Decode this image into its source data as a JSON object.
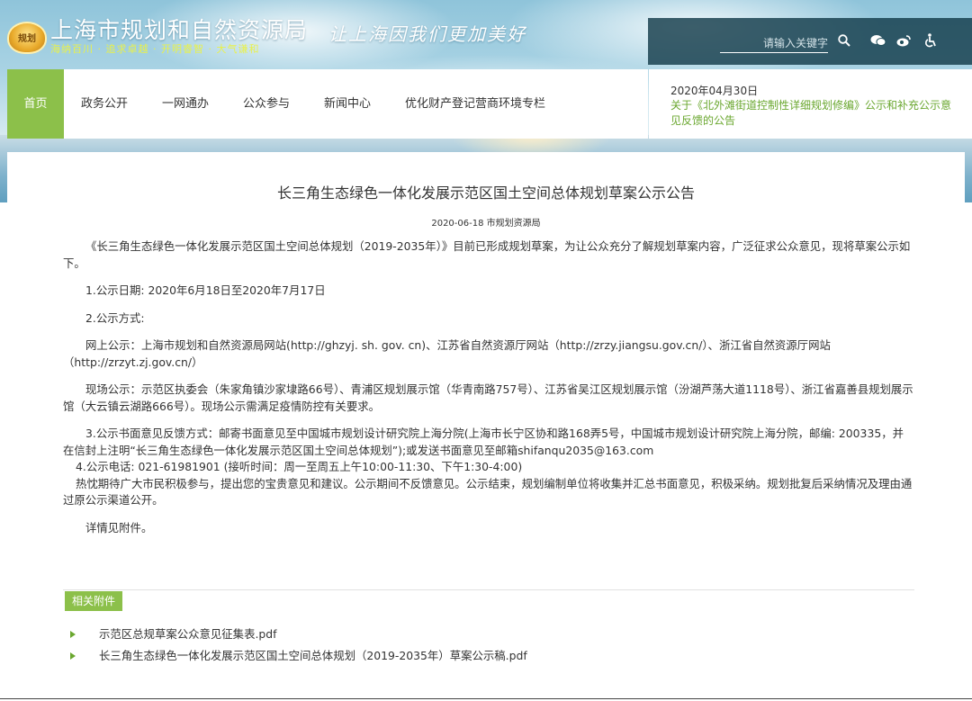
{
  "header": {
    "emblem_text": "规划",
    "site_title": "上海市规划和自然资源局",
    "tagline": "海纳百川 · 追求卓越 · 开明睿智 · 大气谦和",
    "slogan": "让上海因我们更加美好",
    "search_placeholder": "请输入关键字",
    "icons": [
      "search-icon",
      "wechat-icon",
      "weibo-icon",
      "accessibility-icon"
    ]
  },
  "nav": {
    "items": [
      {
        "label": "首页",
        "active": true
      },
      {
        "label": "政务公开"
      },
      {
        "label": "一网通办"
      },
      {
        "label": "公众参与"
      },
      {
        "label": "新闻中心"
      },
      {
        "label": "优化财产登记营商环境专栏"
      }
    ],
    "accent_color": "#8cc04a"
  },
  "news": {
    "date": "2020年04月30日",
    "title": "关于《北外滩街道控制性详细规划修编》公示和补充公示意见反馈的公告"
  },
  "article": {
    "title": "长三角生态绿色一体化发展示范区国土空间总体规划草案公示公告",
    "date": "2020-06-18",
    "source": "市规划资源局",
    "paragraphs": [
      "《长三角生态绿色一体化发展示范区国土空间总体规划（2019-2035年）》目前已形成规划草案，为让公众充分了解规划草案内容，广泛征求公众意见，现将草案公示如下。",
      "1.公示日期: 2020年6月18日至2020年7月17日",
      "2.公示方式:",
      "网上公示：上海市规划和自然资源局网站(http://ghzyj. sh. gov. cn)、江苏省自然资源厅网站（http://zrzy.jiangsu.gov.cn/）、浙江省自然资源厅网站（http://zrzyt.zj.gov.cn/）",
      "现场公示：示范区执委会（朱家角镇沙家埭路66号）、青浦区规划展示馆（华青南路757号）、江苏省吴江区规划展示馆（汾湖芦荡大道1118号）、浙江省嘉善县规划展示馆（大云镇云湖路666号）。现场公示需满足疫情防控有关要求。",
      "3.公示书面意见反馈方式：邮寄书面意见至中国城市规划设计研究院上海分院(上海市长宁区协和路168弄5号，中国城市规划设计研究院上海分院，邮编: 200335，并在信封上注明“长三角生态绿色一体化发展示范区国土空间总体规划”);或发送书面意见至邮箱shifanqu2035@163.com",
      "4.公示电话: 021-61981901 (接听时间：周一至周五上午10:00-11:30、下午1:30-4:00)",
      "热忱期待广大市民积极参与，提出您的宝贵意见和建议。公示期间不反馈意见。公示结束，规划编制单位将收集并汇总书面意见，积极采纳。规划批复后采纳情况及理由通过原公示渠道公开。",
      "详情见附件。"
    ]
  },
  "attachments": {
    "label": "相关附件",
    "items": [
      "示范区总规草案公众意见征集表.pdf",
      "长三角生态绿色一体化发展示范区国土空间总体规划（2019-2035年）草案公示稿.pdf"
    ]
  }
}
